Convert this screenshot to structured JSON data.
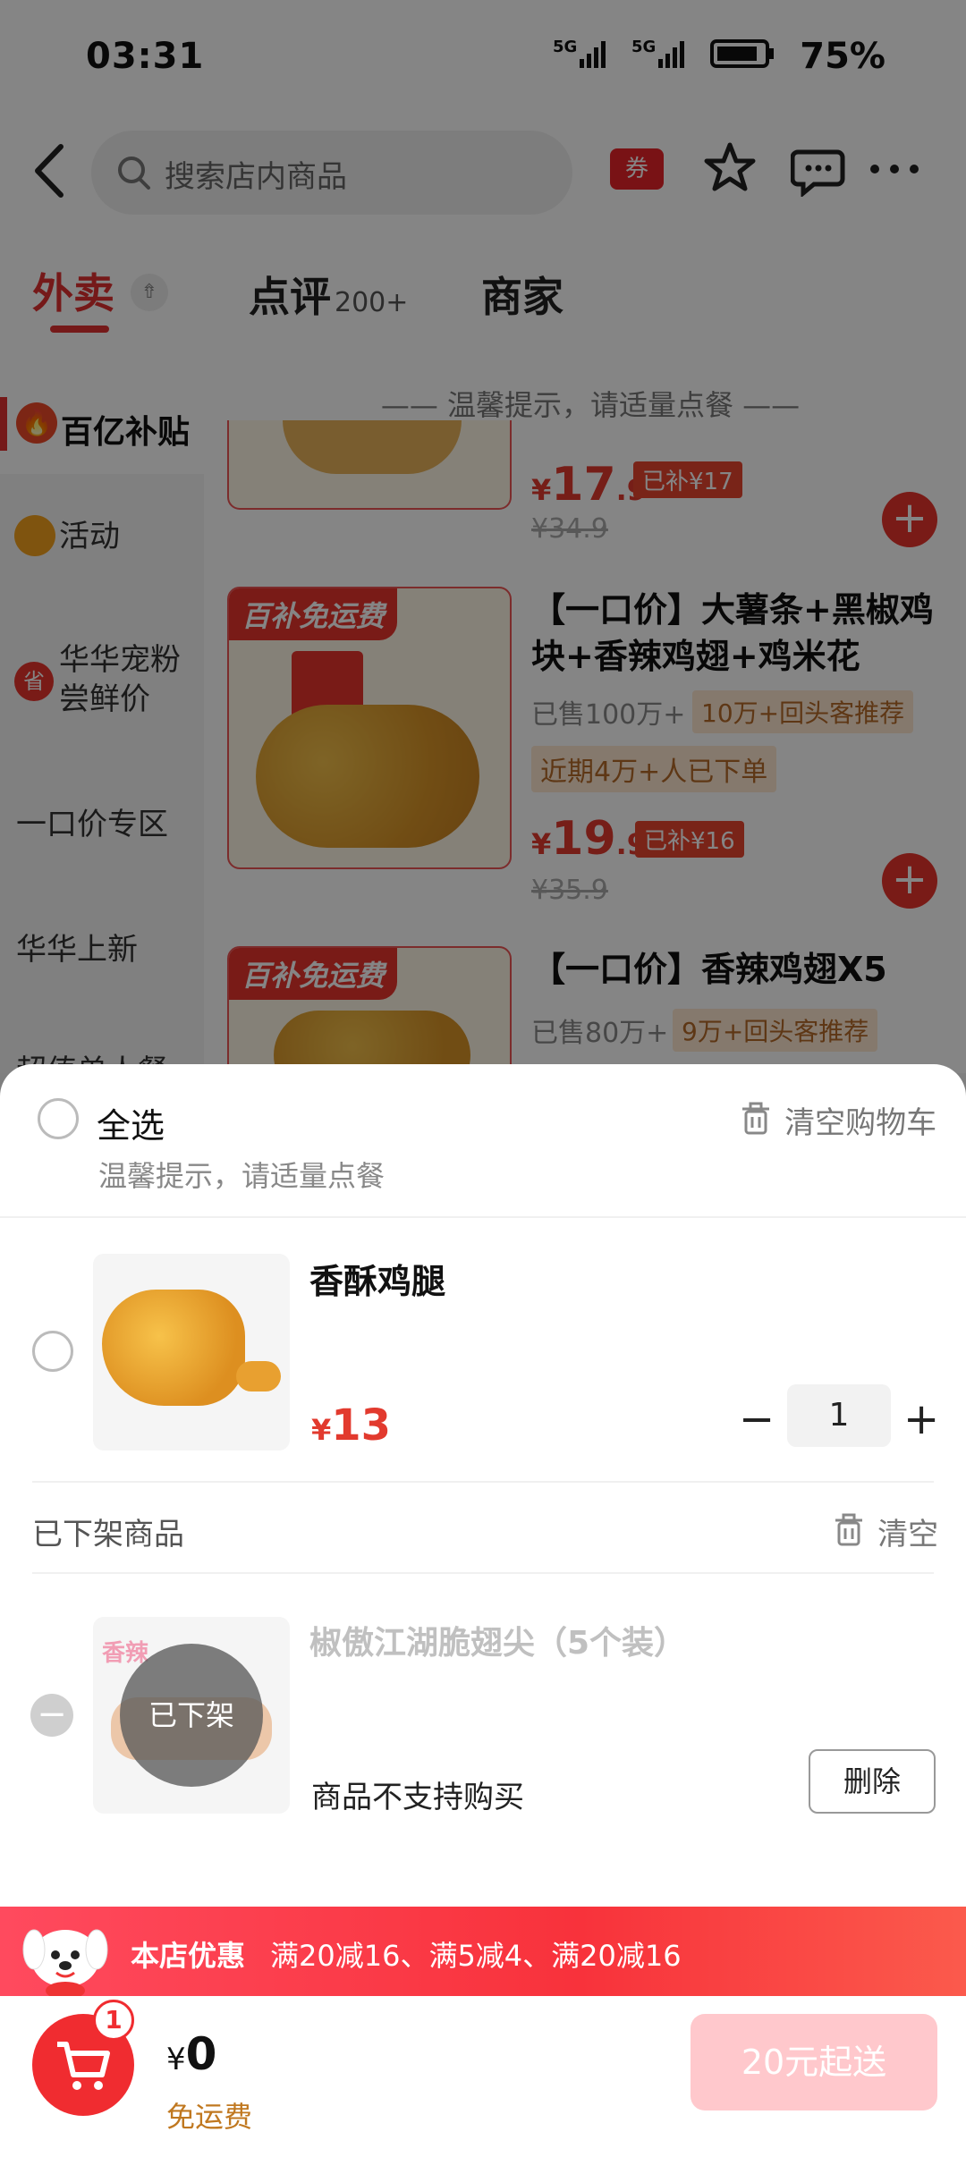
{
  "status": {
    "time": "03:31",
    "battery": "75%",
    "net1": "5G",
    "net2": "5G"
  },
  "header": {
    "search_placeholder": "搜索店内商品",
    "coupon_label": "券"
  },
  "tabs": [
    {
      "label": "外卖"
    },
    {
      "label": "点评",
      "count": "200+"
    },
    {
      "label": "商家"
    }
  ],
  "sidebar": {
    "top_label": "百亿补贴",
    "items": [
      "活动",
      "华华宠粉尝鲜价",
      "一口价专区",
      "华华上新",
      "超值单人餐"
    ]
  },
  "list_notice": "温馨提示，请适量点餐",
  "products": [
    {
      "price_int": "17",
      "price_dec": ".9",
      "subsidy": "已补¥17",
      "orig": "¥34.9"
    },
    {
      "badge": "百补免运费",
      "title": "【一口价】大薯条+黑椒鸡块+香辣鸡翅+鸡米花",
      "sold": "已售100万+",
      "tag1": "10万+回头客推荐",
      "tag2": "近期4万+人已下单",
      "price_int": "19",
      "price_dec": ".9",
      "subsidy": "已补¥16",
      "orig": "¥35.9"
    },
    {
      "badge": "百补免运费",
      "title": "【一口价】香辣鸡翅X5",
      "sold": "已售80万+",
      "tag1": "9万+回头客推荐"
    }
  ],
  "cart": {
    "select_all": "全选",
    "notice": "温馨提示，请适量点餐",
    "clear_cart": "清空购物车",
    "item": {
      "name": "香酥鸡腿",
      "currency": "¥",
      "price": "13",
      "qty": "1"
    },
    "removed_section": "已下架商品",
    "clear": "清空",
    "removed_item": {
      "name": "椒傲江湖脆翅尖（5个装）",
      "overlay": "已下架",
      "note": "商品不支持购买",
      "delete": "删除"
    }
  },
  "promo": {
    "label": "本店优惠",
    "text": "满20减16、满5减4、满20减16"
  },
  "footer": {
    "badge": "1",
    "currency": "¥",
    "total": "0",
    "delivery": "免运费",
    "min_order": "20元起送"
  }
}
